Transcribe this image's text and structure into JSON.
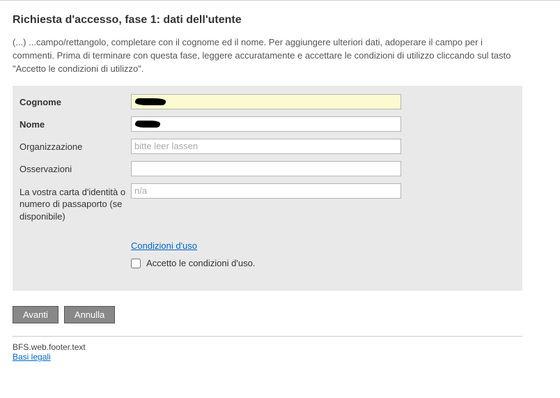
{
  "heading": "Richiesta d'accesso, fase 1: dati dell'utente",
  "intro": "(...) ...campo/rettangolo, completare con il cognome ed il nome. Per aggiungere ulteriori dati, adoperare il campo per i commenti. Prima di terminare con questa fase, leggere accuratamente e accettare le condizioni di utilizzo cliccando sul tasto \"Accetto le condizioni di utilizzo\".",
  "form": {
    "cognome_label": "Cognome",
    "cognome_value": "",
    "nome_label": "Nome",
    "nome_value": "",
    "org_label": "Organizzazione",
    "org_placeholder": "bitte leer lassen",
    "oss_label": "Osservazioni",
    "id_label": "La vostra carta d'identità o numero di passaporto (se disponibile)",
    "id_placeholder": "n/a",
    "tos_link": "Condizioni d'uso",
    "tos_checkbox_label": "Accetto le condizioni d'uso."
  },
  "buttons": {
    "forward": "Avanti",
    "cancel": "Annulla"
  },
  "footer": {
    "text": "BFS.web.footer.text",
    "legal": "Basi legali"
  }
}
